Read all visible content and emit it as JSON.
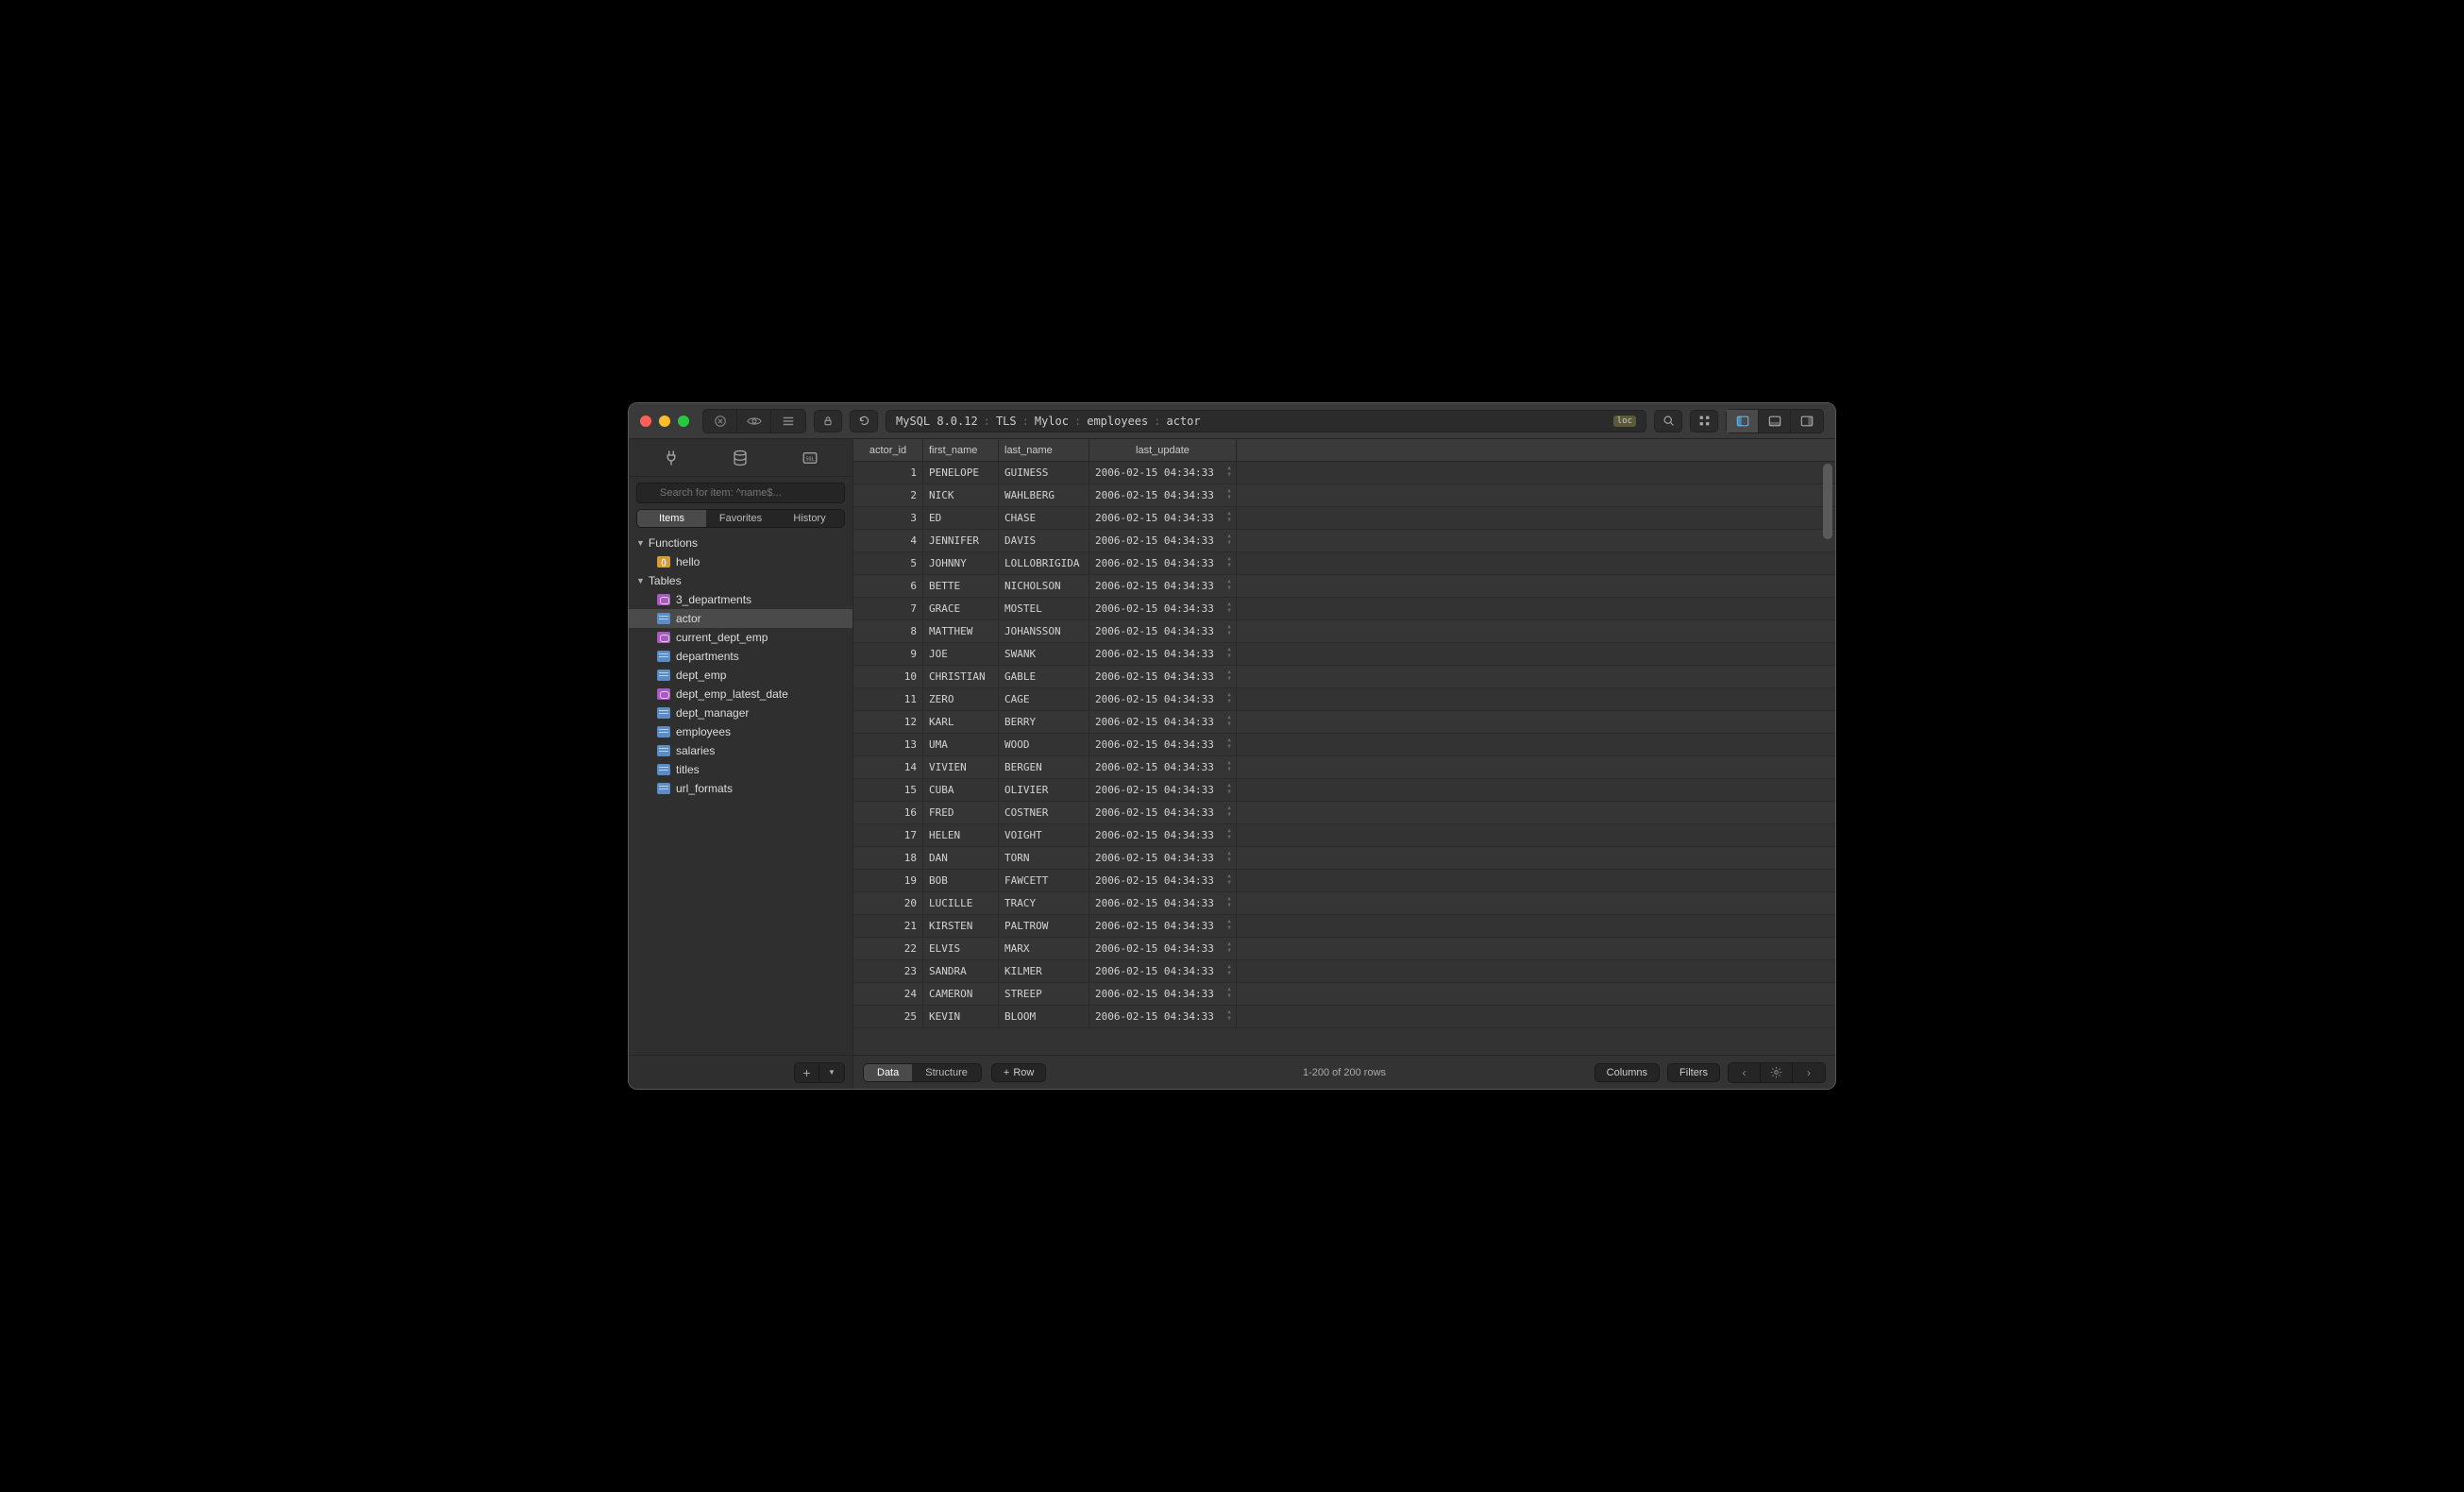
{
  "breadcrumb": {
    "db_version": "MySQL 8.0.12",
    "tls": "TLS",
    "host": "Myloc",
    "database": "employees",
    "table": "actor",
    "badge": "loc"
  },
  "sidebar": {
    "search_placeholder": "Search for item: ^name$...",
    "segments": {
      "items": "Items",
      "favorites": "Favorites",
      "history": "History"
    },
    "sections": {
      "functions": "Functions",
      "tables": "Tables"
    },
    "functions": [
      {
        "name": "hello",
        "type": "func"
      }
    ],
    "tables": [
      {
        "name": "3_departments",
        "type": "view"
      },
      {
        "name": "actor",
        "type": "table",
        "selected": true
      },
      {
        "name": "current_dept_emp",
        "type": "view"
      },
      {
        "name": "departments",
        "type": "table"
      },
      {
        "name": "dept_emp",
        "type": "table"
      },
      {
        "name": "dept_emp_latest_date",
        "type": "view"
      },
      {
        "name": "dept_manager",
        "type": "table"
      },
      {
        "name": "employees",
        "type": "table"
      },
      {
        "name": "salaries",
        "type": "table"
      },
      {
        "name": "titles",
        "type": "table"
      },
      {
        "name": "url_formats",
        "type": "table"
      }
    ]
  },
  "columns": {
    "actor_id": "actor_id",
    "first_name": "first_name",
    "last_name": "last_name",
    "last_update": "last_update"
  },
  "rows": [
    {
      "id": 1,
      "first": "PENELOPE",
      "last": "GUINESS",
      "updated": "2006-02-15 04:34:33"
    },
    {
      "id": 2,
      "first": "NICK",
      "last": "WAHLBERG",
      "updated": "2006-02-15 04:34:33"
    },
    {
      "id": 3,
      "first": "ED",
      "last": "CHASE",
      "updated": "2006-02-15 04:34:33"
    },
    {
      "id": 4,
      "first": "JENNIFER",
      "last": "DAVIS",
      "updated": "2006-02-15 04:34:33"
    },
    {
      "id": 5,
      "first": "JOHNNY",
      "last": "LOLLOBRIGIDA",
      "updated": "2006-02-15 04:34:33"
    },
    {
      "id": 6,
      "first": "BETTE",
      "last": "NICHOLSON",
      "updated": "2006-02-15 04:34:33"
    },
    {
      "id": 7,
      "first": "GRACE",
      "last": "MOSTEL",
      "updated": "2006-02-15 04:34:33"
    },
    {
      "id": 8,
      "first": "MATTHEW",
      "last": "JOHANSSON",
      "updated": "2006-02-15 04:34:33"
    },
    {
      "id": 9,
      "first": "JOE",
      "last": "SWANK",
      "updated": "2006-02-15 04:34:33"
    },
    {
      "id": 10,
      "first": "CHRISTIAN",
      "last": "GABLE",
      "updated": "2006-02-15 04:34:33"
    },
    {
      "id": 11,
      "first": "ZERO",
      "last": "CAGE",
      "updated": "2006-02-15 04:34:33"
    },
    {
      "id": 12,
      "first": "KARL",
      "last": "BERRY",
      "updated": "2006-02-15 04:34:33"
    },
    {
      "id": 13,
      "first": "UMA",
      "last": "WOOD",
      "updated": "2006-02-15 04:34:33"
    },
    {
      "id": 14,
      "first": "VIVIEN",
      "last": "BERGEN",
      "updated": "2006-02-15 04:34:33"
    },
    {
      "id": 15,
      "first": "CUBA",
      "last": "OLIVIER",
      "updated": "2006-02-15 04:34:33"
    },
    {
      "id": 16,
      "first": "FRED",
      "last": "COSTNER",
      "updated": "2006-02-15 04:34:33"
    },
    {
      "id": 17,
      "first": "HELEN",
      "last": "VOIGHT",
      "updated": "2006-02-15 04:34:33"
    },
    {
      "id": 18,
      "first": "DAN",
      "last": "TORN",
      "updated": "2006-02-15 04:34:33"
    },
    {
      "id": 19,
      "first": "BOB",
      "last": "FAWCETT",
      "updated": "2006-02-15 04:34:33"
    },
    {
      "id": 20,
      "first": "LUCILLE",
      "last": "TRACY",
      "updated": "2006-02-15 04:34:33"
    },
    {
      "id": 21,
      "first": "KIRSTEN",
      "last": "PALTROW",
      "updated": "2006-02-15 04:34:33"
    },
    {
      "id": 22,
      "first": "ELVIS",
      "last": "MARX",
      "updated": "2006-02-15 04:34:33"
    },
    {
      "id": 23,
      "first": "SANDRA",
      "last": "KILMER",
      "updated": "2006-02-15 04:34:33"
    },
    {
      "id": 24,
      "first": "CAMERON",
      "last": "STREEP",
      "updated": "2006-02-15 04:34:33"
    },
    {
      "id": 25,
      "first": "KEVIN",
      "last": "BLOOM",
      "updated": "2006-02-15 04:34:33"
    }
  ],
  "bottombar": {
    "data": "Data",
    "structure": "Structure",
    "row": "Row",
    "status": "1-200 of 200 rows",
    "columns": "Columns",
    "filters": "Filters"
  }
}
